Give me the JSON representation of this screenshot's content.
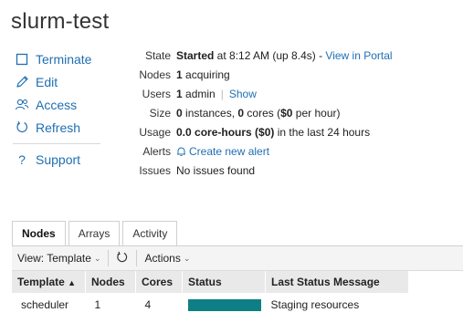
{
  "header": {
    "title": "slurm-test"
  },
  "sidebar": {
    "items": [
      {
        "label": "Terminate"
      },
      {
        "label": "Edit"
      },
      {
        "label": "Access"
      },
      {
        "label": "Refresh"
      },
      {
        "label": "Support"
      }
    ]
  },
  "info": {
    "state": {
      "label": "State",
      "status": "Started",
      "rest": " at 8:12 AM (up 8.4s) - ",
      "link": "View in Portal"
    },
    "nodes": {
      "label": "Nodes",
      "count": "1",
      "rest": " acquiring"
    },
    "users": {
      "label": "Users",
      "count": "1",
      "rest": " admin",
      "link": "Show"
    },
    "size": {
      "label": "Size",
      "instances": "0",
      "t1": " instances, ",
      "cores": "0",
      "t2": " cores (",
      "price": "$0",
      "t3": " per hour)"
    },
    "usage": {
      "label": "Usage",
      "amount": "0.0 core-hours ($0)",
      "rest": " in the last 24 hours"
    },
    "alerts": {
      "label": "Alerts",
      "link": "Create new alert"
    },
    "issues": {
      "label": "Issues",
      "text": "No issues found"
    }
  },
  "tabs": [
    {
      "label": "Nodes",
      "active": true
    },
    {
      "label": "Arrays",
      "active": false
    },
    {
      "label": "Activity",
      "active": false
    }
  ],
  "toolbar": {
    "view_label": "View: Template",
    "actions_label": "Actions"
  },
  "table": {
    "headers": [
      "Template",
      "Nodes",
      "Cores",
      "Status",
      "Last Status Message"
    ],
    "sort_indicator": "▲",
    "rows": [
      {
        "template": "scheduler",
        "nodes": "1",
        "cores": "4",
        "status_fill": 1.0,
        "message": "Staging resources"
      }
    ]
  },
  "colors": {
    "link": "#1f6fb2",
    "status_bar": "#0e8085"
  }
}
